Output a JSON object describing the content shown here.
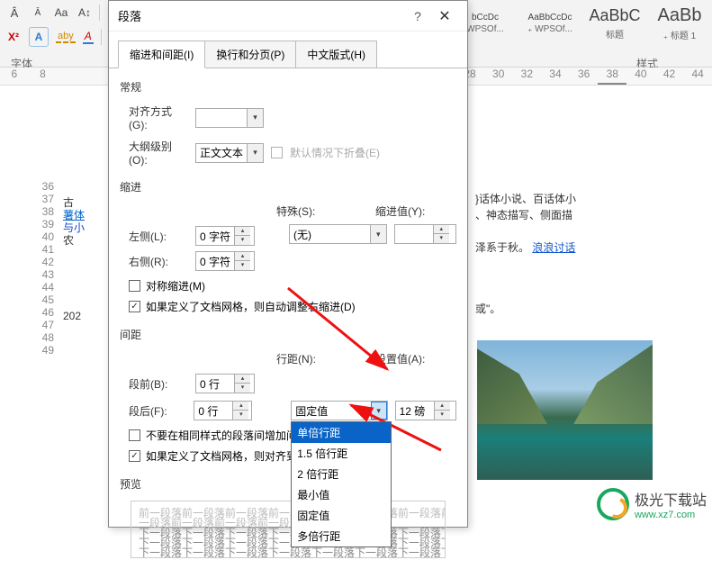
{
  "ribbon": {
    "font_group_label": "字体",
    "styles_group_label": "样式",
    "styles": [
      {
        "sample": "bCcDc",
        "label": "WPSOf..."
      },
      {
        "sample": "AaBbCcDc",
        "label": "₊ WPSOf..."
      },
      {
        "sample": "AaBbC",
        "label": "标题"
      },
      {
        "sample": "AaBb",
        "label": "₊ 标题 1"
      }
    ],
    "icon_a_up": "A",
    "icon_a_dn": "A",
    "icon_aa": "Aa",
    "icon_x": "X²",
    "icon_blueA": "A",
    "icon_aby": "aby",
    "icon_aA": "A"
  },
  "ruler": {
    "left_marks": [
      "6",
      "8"
    ],
    "right_marks": [
      "28",
      "30",
      "32",
      "34",
      "36",
      "38",
      "40",
      "42",
      "44"
    ]
  },
  "doc": {
    "line_numbers": [
      "36",
      "37",
      "38",
      "39",
      "40",
      "41",
      "42",
      "43",
      "44",
      "45",
      "46",
      "47",
      "",
      "48",
      "",
      "49"
    ],
    "frag_lines": [
      "古",
      "薯体",
      "与小",
      "农",
      "",
      "",
      "202"
    ],
    "right_lines": [
      "}话体小说、百话体小",
      "、神态描写、侧面描",
      "",
      "泽系于秋。"
    ],
    "right_link": "浪浪讨话",
    "end_line": "或\"。"
  },
  "dialog": {
    "title": "段落",
    "tabs": [
      "缩进和间距(I)",
      "换行和分页(P)",
      "中文版式(H)"
    ],
    "sec_general": "常规",
    "alignment_label": "对齐方式(G):",
    "outline_label": "大纲级别(O):",
    "outline_value": "正文文本",
    "collapse_label": "默认情况下折叠(E)",
    "sec_indent": "缩进",
    "left_indent_label": "左侧(L):",
    "left_indent_value": "0 字符",
    "right_indent_label": "右侧(R):",
    "right_indent_value": "0 字符",
    "special_label": "特殊(S):",
    "special_value": "(无)",
    "by_label": "缩进值(Y):",
    "mirror_label": "对称缩进(M)",
    "auto_right_label": "如果定义了文档网格，则自动调整右缩进(D)",
    "sec_spacing": "间距",
    "before_label": "段前(B):",
    "before_value": "0 行",
    "after_label": "段后(F):",
    "after_value": "0 行",
    "line_spacing_label": "行距(N):",
    "line_spacing_value": "固定值",
    "at_label": "设置值(A):",
    "at_value": "12 磅",
    "no_space_style_label": "不要在相同样式的段落间增加间",
    "snap_grid_label": "如果定义了文档网格，则对齐到",
    "preview_label": "预览",
    "dropdown_options": [
      "单倍行距",
      "1.5 倍行距",
      "2 倍行距",
      "最小值",
      "固定值",
      "多倍行距"
    ],
    "preview_text_line": "前一段落前一段落前一段落前一段落前一段落前一段落前一段落前一段落前一段落前一段落前",
    "preview_text_line2": "一段落前一段落前一段落前一段落前一段落",
    "preview_dark_line": "下一段落下一段落下一段落下一段落下一段落下一段落下一段落下一段落下一段落下一段落下"
  },
  "watermark": {
    "name": "极光下载站",
    "url": "www.xz7.com"
  }
}
